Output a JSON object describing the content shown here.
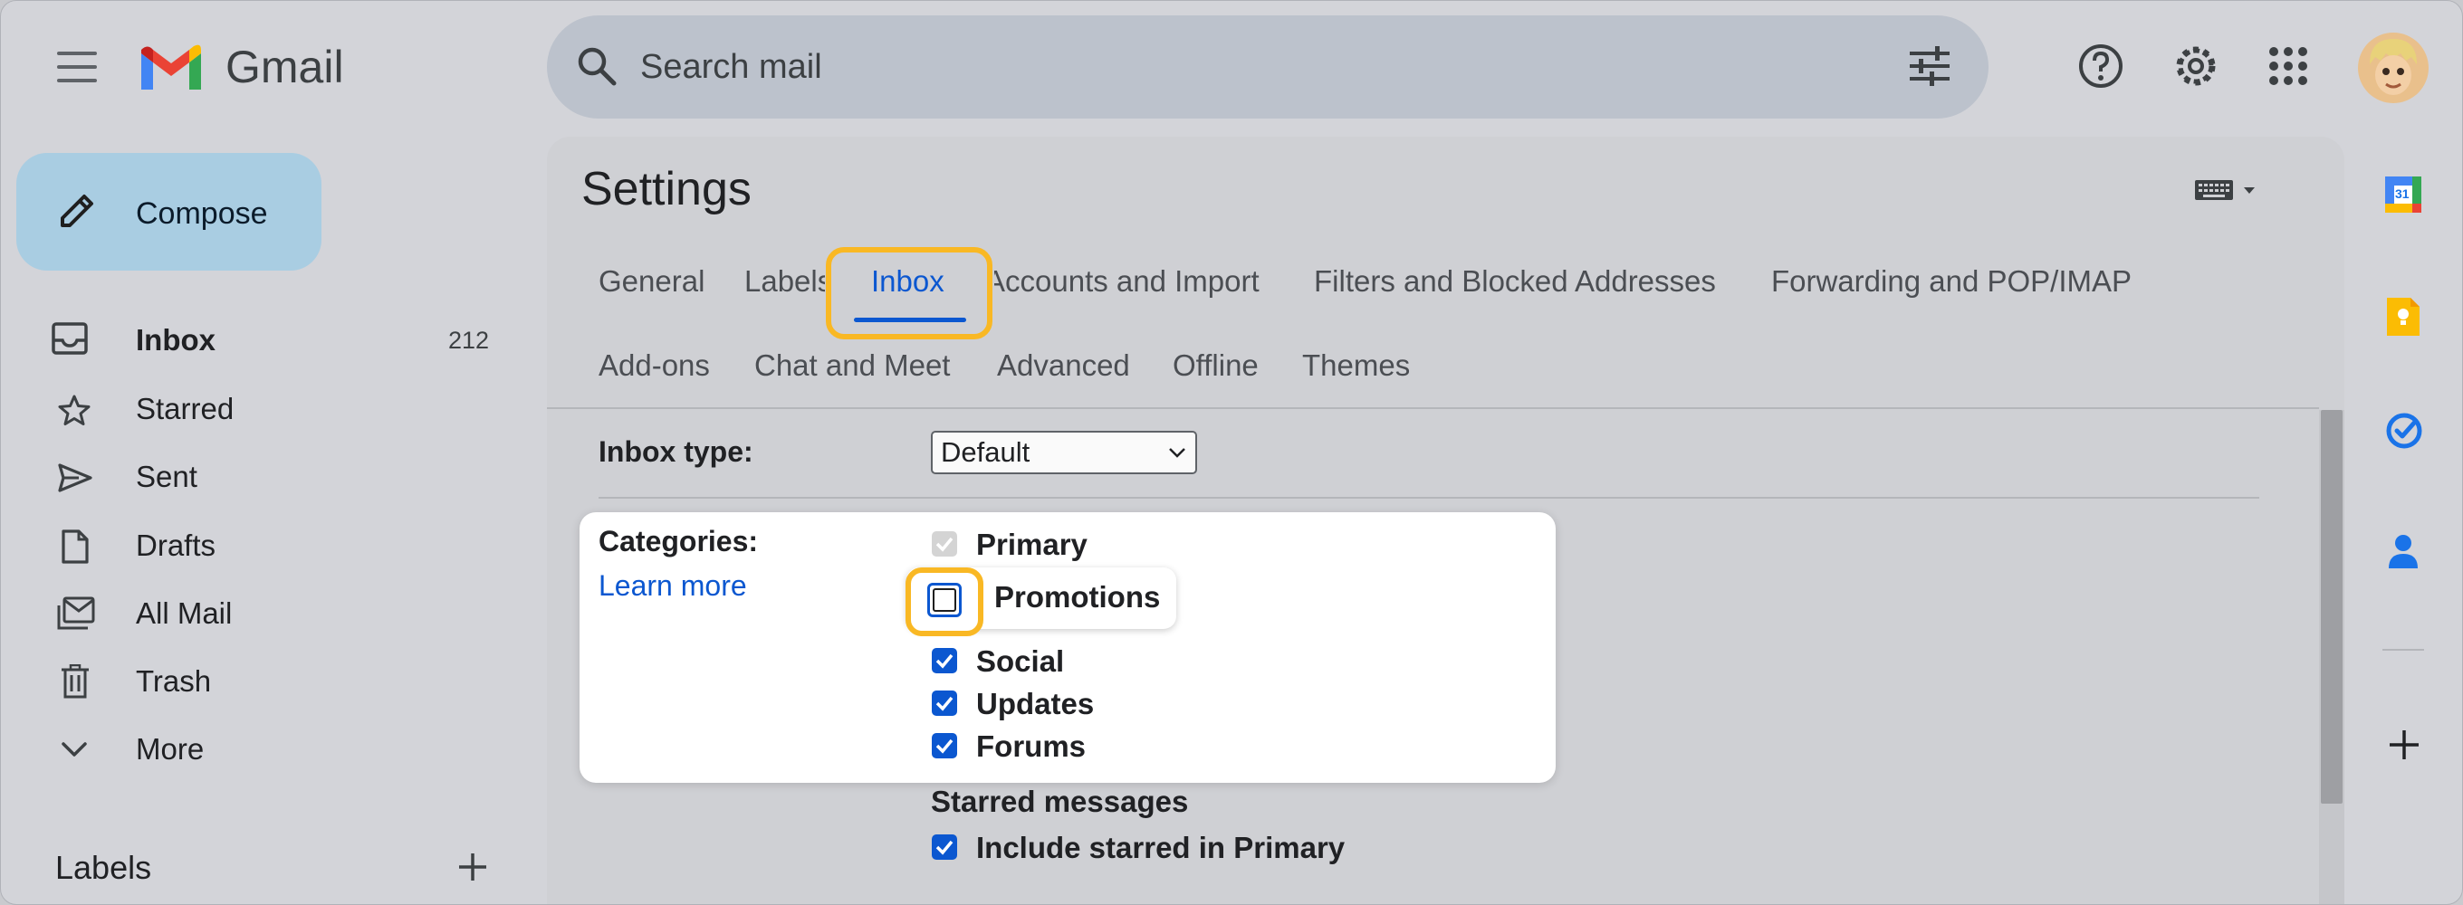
{
  "header": {
    "app_name": "Gmail",
    "search_placeholder": "Search mail"
  },
  "sidebar": {
    "compose_label": "Compose",
    "items": [
      {
        "label": "Inbox",
        "count": "212",
        "bold": true
      },
      {
        "label": "Starred"
      },
      {
        "label": "Sent"
      },
      {
        "label": "Drafts"
      },
      {
        "label": "All Mail"
      },
      {
        "label": "Trash"
      },
      {
        "label": "More"
      }
    ],
    "labels_title": "Labels"
  },
  "settings": {
    "title": "Settings",
    "tabs_row1": [
      "General",
      "Labels",
      "Inbox",
      "Accounts and Import",
      "Filters and Blocked Addresses",
      "Forwarding and POP/IMAP"
    ],
    "tabs_row2": [
      "Add-ons",
      "Chat and Meet",
      "Advanced",
      "Offline",
      "Themes"
    ],
    "active_tab": "Inbox",
    "inbox_type": {
      "label": "Inbox type:",
      "value": "Default"
    },
    "categories": {
      "label": "Categories:",
      "learn_more": "Learn more",
      "options": [
        {
          "label": "Primary",
          "checked": true,
          "disabled": true
        },
        {
          "label": "Promotions",
          "checked": false
        },
        {
          "label": "Social",
          "checked": true
        },
        {
          "label": "Updates",
          "checked": true
        },
        {
          "label": "Forums",
          "checked": true
        }
      ]
    },
    "starred": {
      "heading": "Starred messages",
      "option": {
        "label": "Include starred in Primary",
        "checked": true
      }
    }
  },
  "right_rail": {
    "calendar_icon_text": "31"
  },
  "colors": {
    "accent_blue": "#0b57d0",
    "highlight_yellow": "#f9b824",
    "compose_bg": "#a9cde2"
  }
}
